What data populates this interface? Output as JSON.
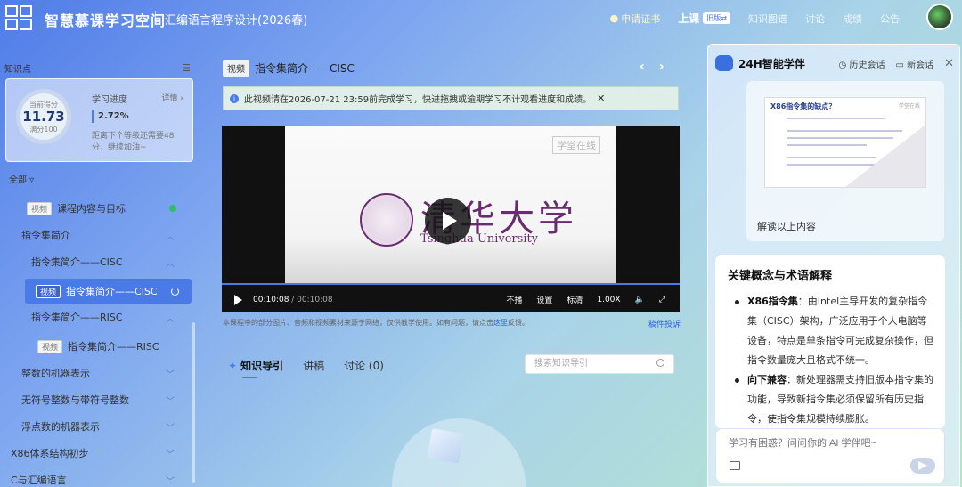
{
  "header": {
    "site_title": "智慧慕课学习空间",
    "course_title": "汇编语言程序设计(2026春)",
    "cert": "申请证书",
    "nav_active": "上课",
    "old_badge": "旧版⇄",
    "nav": [
      "知识图谱",
      "讨论",
      "成绩",
      "公告"
    ]
  },
  "sidebar": {
    "heading": "知识点",
    "progress": {
      "score_label": "当前得分",
      "score": "11.73",
      "full_label": "满分100",
      "title": "学习进度",
      "detail": "详情 ›",
      "percent": "2.72%",
      "note": "距离下个等级还需要48分，继续加油~"
    },
    "filter": "全部 ▿",
    "tree": [
      {
        "tag": "视频",
        "label": "课程内容与目标"
      },
      {
        "label": "指令集简介"
      },
      {
        "label": "指令集简介——CISC"
      },
      {
        "tag": "视频",
        "label": "指令集简介——CISC"
      },
      {
        "label": "指令集简介——RISC"
      },
      {
        "tag": "视频",
        "label": "指令集简介——RISC"
      },
      {
        "label": "整数的机器表示"
      },
      {
        "label": "无符号整数与带符号整数"
      },
      {
        "label": "浮点数的机器表示"
      },
      {
        "label": "X86体系结构初步"
      },
      {
        "label": "C与汇编语言"
      }
    ]
  },
  "main": {
    "video_tag": "视频",
    "video_title": "指令集简介——CISC",
    "notice": "此视频请在2026-07-21 23:59前完成学习，快进拖拽或逾期学习不计观看进度和成绩。",
    "watermark": "学堂在线",
    "university_cn": "清华大学",
    "university_en": "Tsinghua University",
    "time_current": "00:10:08",
    "time_total": " / 00:10:08",
    "controls": [
      "不播",
      "设置",
      "标清",
      "1.00X"
    ],
    "disclaimer_prefix": "本课程中的部分图片、音频和视频素材来源于网络，仅供教学使用。如有问题，请点击",
    "disclaimer_link": "这里",
    "disclaimer_suffix": "反馈。",
    "report": "稿件投诉",
    "tabs": [
      "知识导引",
      "讲稿",
      "讨论 (0)"
    ],
    "search_placeholder": "搜索知识导引"
  },
  "ai": {
    "title": "24H智能学伴",
    "history": "历史会话",
    "new_chat": "新会话",
    "slide_title": "X86指令集的缺点？",
    "slide_mark": "学堂在线",
    "image_caption": "解读以上内容",
    "answer_heading": "关键概念与术语解释",
    "answer_items": [
      {
        "term": "X86指令集",
        "text": "：由Intel主导开发的复杂指令集（CISC）架构，广泛应用于个人电脑等设备，特点是单条指令可完成复杂操作，但指令数量庞大且格式不统一。"
      },
      {
        "term": "向下兼容",
        "text": "：新处理器需支持旧版本指令集的功能，导致新指令集必须保留所有历史指令，使指令集规模持续膨胀。"
      }
    ],
    "input_placeholder": "学习有困惑？问问你的 AI 学伴吧~"
  }
}
